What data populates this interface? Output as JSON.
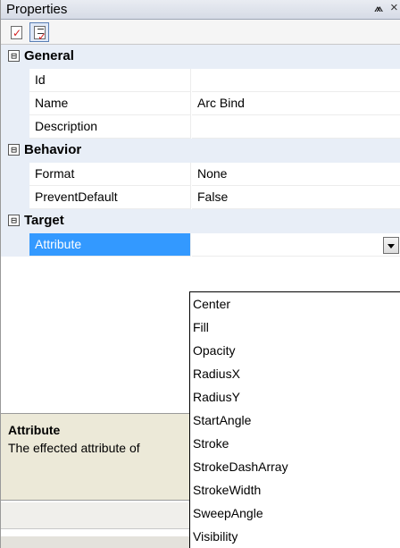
{
  "panel": {
    "title": "Properties",
    "pin_glyph": "⩕",
    "close_glyph": "×"
  },
  "toolbar": {
    "buttons": [
      {
        "icon": "categorized-view-icon"
      },
      {
        "icon": "property-pages-icon",
        "active": true
      }
    ]
  },
  "grid": {
    "categories": [
      {
        "label": "General",
        "expander": "⊟",
        "expanded": true
      },
      {
        "label": "Behavior",
        "expander": "⊟",
        "expanded": true
      },
      {
        "label": "Target",
        "expander": "⊟",
        "expanded": true
      }
    ],
    "rows": [
      {
        "name": "Id",
        "value": ""
      },
      {
        "name": "Name",
        "value": "Arc Bind"
      },
      {
        "name": "Description",
        "value": ""
      },
      {
        "name": "Format",
        "value": "None"
      },
      {
        "name": "PreventDefault",
        "value": "False"
      },
      {
        "name": "Attribute",
        "value": "",
        "selected": true
      }
    ]
  },
  "description": {
    "title": "Attribute",
    "text": "The effected attribute of"
  },
  "dropdown": {
    "options": [
      "Center",
      "Fill",
      "Opacity",
      "RadiusX",
      "RadiusY",
      "StartAngle",
      "Stroke",
      "StrokeDashArray",
      "StrokeWidth",
      "SweepAngle",
      "Visibility"
    ]
  },
  "colors": {
    "selection": "#3399ff",
    "category_bg": "#e8eef7",
    "description_bg": "#ece9d8"
  }
}
